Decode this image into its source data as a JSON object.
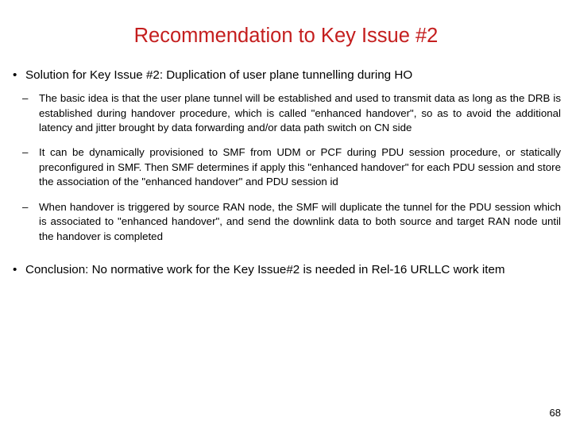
{
  "slide": {
    "title": "Recommendation to Key Issue #2",
    "title_color": "#c41e1e",
    "background_color": "#ffffff",
    "page_number": "68",
    "bullet_marker": "•",
    "sub_bullet_marker": "–",
    "blocks": [
      {
        "level": 1,
        "text": "Solution for Key Issue #2: Duplication of user plane tunnelling during HO"
      },
      {
        "level": 2,
        "text": "The basic idea is that the user plane tunnel will be established and used to transmit data as long as the DRB is established during handover procedure, which is called \"enhanced handover\", so as to avoid the additional latency and jitter brought by data forwarding and/or data path switch on CN side"
      },
      {
        "level": 2,
        "text": "It can be dynamically provisioned to SMF from UDM or PCF during PDU session procedure, or statically preconfigured in SMF. Then SMF determines if apply this \"enhanced handover\" for each PDU session and store the association of the \"enhanced handover\" and PDU session id"
      },
      {
        "level": 2,
        "text": "When handover is triggered by source RAN node, the SMF will duplicate the tunnel for the PDU session which is associated to \"enhanced handover\", and send the downlink data to both source and target RAN node until the handover is completed"
      },
      {
        "level": 1,
        "text": "Conclusion: No normative work for the Key Issue#2 is needed in Rel-16 URLLC work item"
      }
    ]
  }
}
